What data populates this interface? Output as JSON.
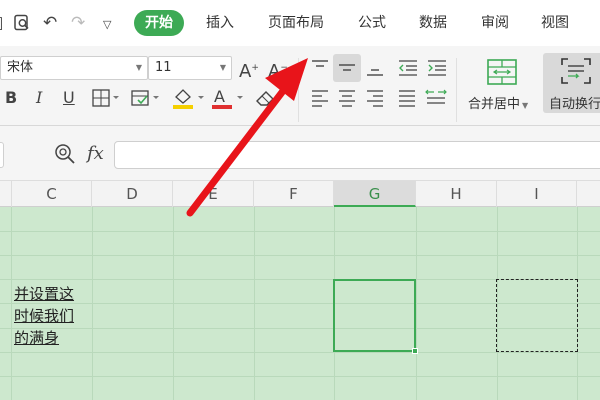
{
  "menubar": {
    "tabs": [
      "开始",
      "插入",
      "页面布局",
      "公式",
      "数据",
      "审阅",
      "视图"
    ],
    "quick_access": [
      "print-preview-icon",
      "undo-icon",
      "redo-icon",
      "customize-icon"
    ]
  },
  "ribbon": {
    "font_name": "宋体",
    "font_size": "11",
    "merge_center_label": "合并居中",
    "wrap_text_label": "自动换行",
    "highlight_color": "#f5d000",
    "font_color": "#e03030"
  },
  "formula_bar": {
    "fx_label": "fx",
    "value": ""
  },
  "columns": [
    "C",
    "D",
    "E",
    "F",
    "G",
    "H",
    "I"
  ],
  "cell_text_lines": [
    "并设置这",
    "时候我们",
    "的满身"
  ],
  "colors": {
    "accent": "#3daa55",
    "sheet_bg": "#cde8ce",
    "arrow": "#e8141a"
  }
}
